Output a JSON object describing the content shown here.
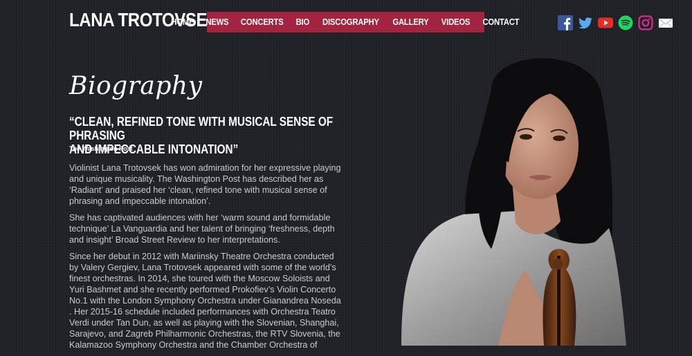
{
  "site": {
    "title": "LANA TROTOVSEK"
  },
  "nav": {
    "items": [
      {
        "label": "HOME",
        "name": "nav-home"
      },
      {
        "label": "NEWS",
        "name": "nav-news"
      },
      {
        "label": "CONCERTS",
        "name": "nav-concerts"
      },
      {
        "label": "BIO",
        "name": "nav-bio"
      },
      {
        "label": "DISCOGRAPHY",
        "name": "nav-discography"
      },
      {
        "label": "GALLERY",
        "name": "nav-gallery"
      },
      {
        "label": "VIDEOS",
        "name": "nav-videos"
      },
      {
        "label": "CONTACT",
        "name": "nav-contact"
      }
    ]
  },
  "social": {
    "icons": [
      "facebook-icon",
      "twitter-icon",
      "youtube-icon",
      "spotify-icon",
      "instagram-icon",
      "email-icon"
    ]
  },
  "colors": {
    "accent": "#a3243f",
    "background": "#1f2126",
    "text": "#ffffff",
    "body_text": "#c9cbd0"
  },
  "bio": {
    "heading": "Biography",
    "quote_line1": "“CLEAN, REFINED TONE WITH MUSICAL SENSE OF PHRASING",
    "quote_line2": "AND IMPECCABLE INTONATION”",
    "quote_source": "The Washington Post",
    "paragraphs": [
      "Violinist Lana Trotovsek has won admiration for her expressive playing and unique musicality. The Washington Post has described her as ‘Radiant’ and praised her ‘clean, refined tone with musical sense of phrasing and impeccable intonation’.",
      "She has captivated audiences with her ‘warm sound and formidable technique’ La Vanguardia and her talent of bringing ‘freshness, depth and insight’ Broad Street Review to her interpretations.",
      "Since her debut in 2012 with Mariinsky Theatre Orchestra conducted by Valery Gergiev, Lana Trotovsek appeared with some of the world’s finest orchestras.  In 2014, she toured with the Moscow Soloists and Yuri Bashmet and she recently performed Prokofiev’s Violin Concerto No.1 with the London Symphony Orchestra under Gianandrea Noseda .  Her 2015-16 schedule  included performances with Orchestra Teatro Verdi under Tan Dun, as well as playing with the Slovenian, Shanghai, Sarajevo, and Zagreb Philharmonic Orchestras, the RTV Slovenia, the Kalamazoo Symphony Orchestra and the Chamber Orchestra of"
    ]
  }
}
